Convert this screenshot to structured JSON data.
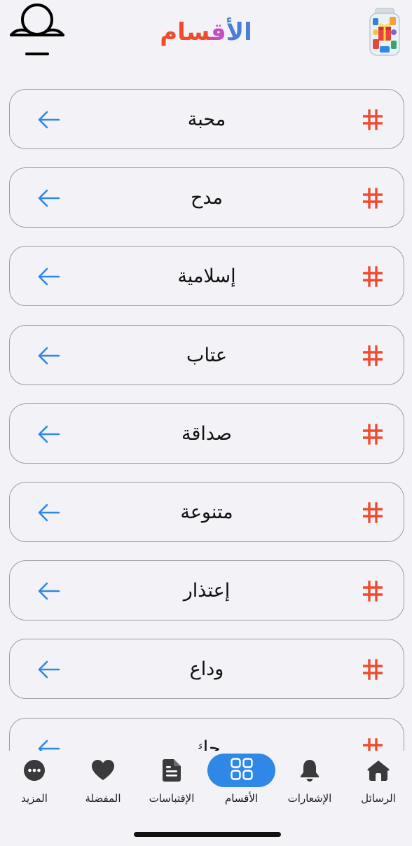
{
  "header": {
    "title": "الأقسام",
    "title_colors": [
      "#ef4b2e",
      "#4a7fd8",
      "#c84dbf"
    ]
  },
  "categories": [
    {
      "label": "محبة"
    },
    {
      "label": "مدح"
    },
    {
      "label": "إسلامية"
    },
    {
      "label": "عتاب"
    },
    {
      "label": "صداقة"
    },
    {
      "label": "متنوعة"
    },
    {
      "label": "إعتذار"
    },
    {
      "label": "وداع"
    },
    {
      "label": "حك"
    }
  ],
  "row_icons": {
    "left": "arrow-left-icon",
    "right": "hash-icon"
  },
  "colors": {
    "accent_blue": "#2f88e6",
    "hash_orange": "#ef4b2e",
    "background": "#f2f2f7",
    "border": "#9c9ca2"
  },
  "tabbar": {
    "active_index": 2,
    "tabs": [
      {
        "label": "المزيد",
        "icon": "more-icon"
      },
      {
        "label": "المفضلة",
        "icon": "heart-icon"
      },
      {
        "label": "الأقسام",
        "icon": "grid-icon"
      },
      {
        "label": "الإقتباسات",
        "icon": "document-icon"
      },
      {
        "label": "الإشعارات",
        "icon": "bell-icon"
      },
      {
        "label": "الرسائل",
        "icon": "home-icon"
      }
    ]
  }
}
